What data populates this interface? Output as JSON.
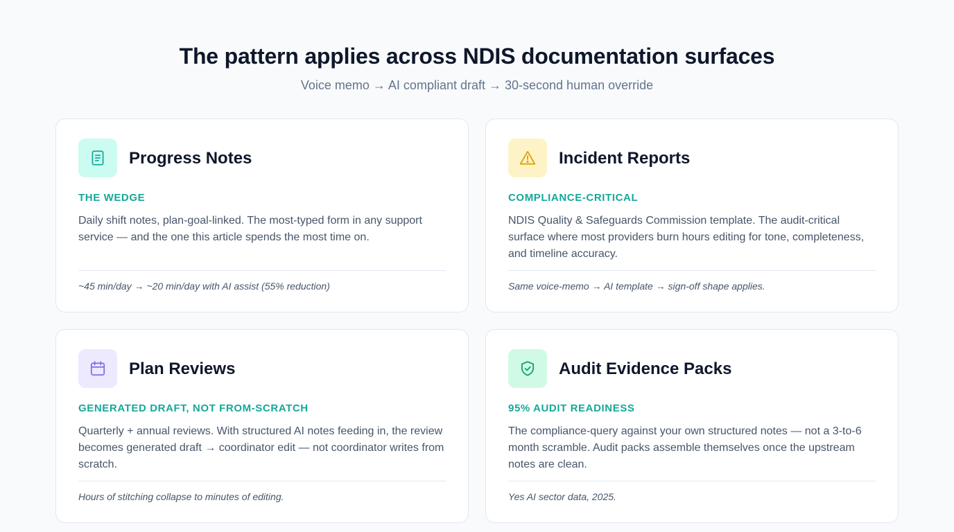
{
  "header": {
    "title": "The pattern applies across NDIS documentation surfaces",
    "subtitle": "Voice memo → AI compliant draft → 30-second human override"
  },
  "cards": [
    {
      "icon": "document-icon",
      "icon_bg": "#ccfbf1",
      "icon_color": "#14a89a",
      "title": "Progress Notes",
      "tag": "THE WEDGE",
      "description": "Daily shift notes, plan-goal-linked. The most-typed form in any support service — and the one this article spends the most time on.",
      "footnote": "~45 min/day → ~20 min/day with AI assist (55% reduction)"
    },
    {
      "icon": "warning-icon",
      "icon_bg": "#fef3c7",
      "icon_color": "#e0a200",
      "title": "Incident Reports",
      "tag": "COMPLIANCE-CRITICAL",
      "description": "NDIS Quality & Safeguards Commission template. The audit-critical surface where most providers burn hours editing for tone, completeness, and timeline accuracy.",
      "footnote": "Same voice-memo → AI template → sign-off shape applies."
    },
    {
      "icon": "calendar-icon",
      "icon_bg": "#ede9fe",
      "icon_color": "#7c6ee6",
      "title": "Plan Reviews",
      "tag": "GENERATED DRAFT, NOT FROM-SCRATCH",
      "description": "Quarterly + annual reviews. With structured AI notes feeding in, the review becomes generated draft → coordinator edit — not coordinator writes from scratch.",
      "footnote": "Hours of stitching collapse to minutes of editing."
    },
    {
      "icon": "shield-check-icon",
      "icon_bg": "#d1fae5",
      "icon_color": "#10a36e",
      "title": "Audit Evidence Packs",
      "tag": "95% AUDIT READINESS",
      "description": "The compliance-query against your own structured notes — not a 3-to-6 month scramble. Audit packs assemble themselves once the upstream notes are clean.",
      "footnote": "Yes AI sector data, 2025."
    }
  ]
}
